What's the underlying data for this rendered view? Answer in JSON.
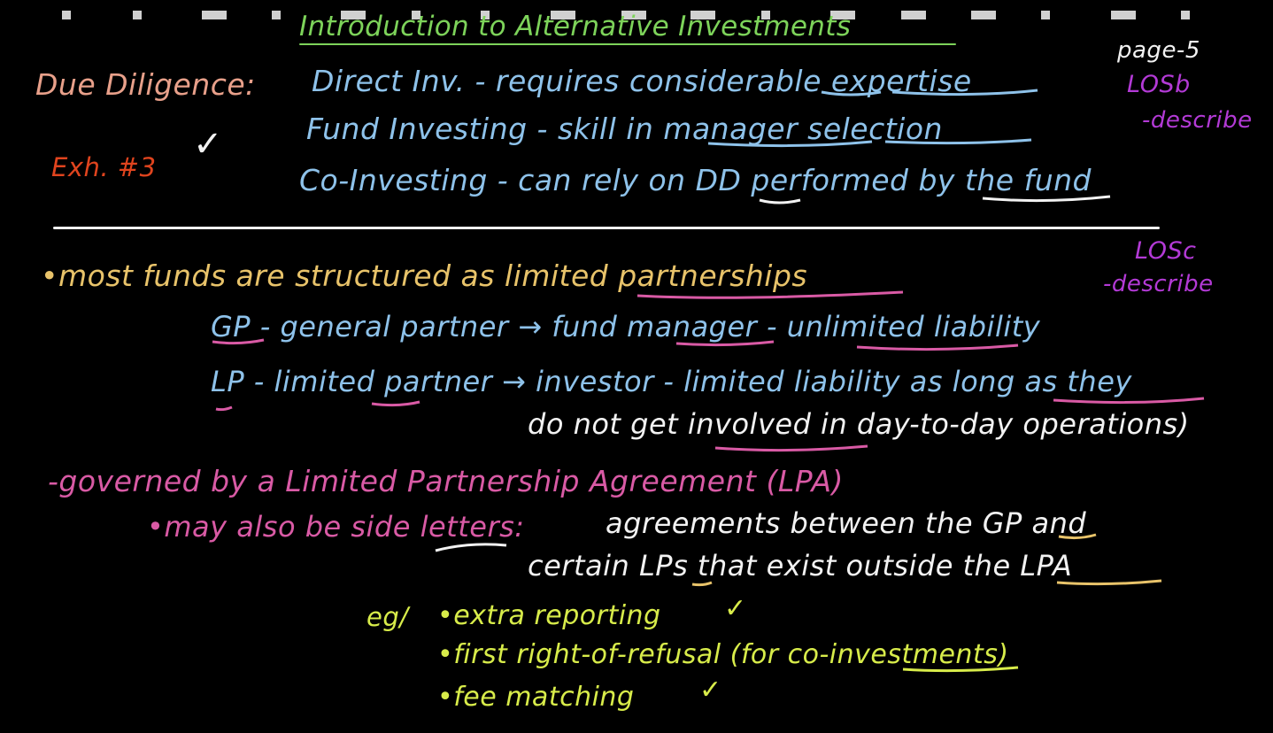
{
  "colors": {
    "background": "#000000",
    "title": "#7dd35a",
    "salmon": "#e8a08a",
    "red": "#e0441e",
    "blue": "#8ec2ea",
    "white": "#f2f2f2",
    "magenta": "#b33ad6",
    "gold": "#e8c36a",
    "pink": "#d95aa5",
    "yellow": "#d8ec4a"
  },
  "header": {
    "title": "Introduction to Alternative Investments",
    "page": "page-5"
  },
  "los": {
    "b": {
      "code": "LOSb",
      "verb": "-describe"
    },
    "c": {
      "code": "LOSc",
      "verb": "-describe"
    }
  },
  "due_diligence": {
    "heading": "Due Diligence:",
    "exhibit": "Exh. #3",
    "check": "✓",
    "lines": [
      "Direct Inv. - requires considerable expertise",
      "Fund Investing - skill in manager selection",
      "Co-Investing - can rely on DD performed by the fund"
    ]
  },
  "structure": {
    "bullet": "•most funds are structured as limited partnerships",
    "gp_line": "GP - general partner → fund manager - unlimited liability",
    "lp_line": "LP - limited partner → investor - limited liability as long as they",
    "lp_line_cont": "do not get involved in day-to-day operations)"
  },
  "lpa": {
    "governed": "-governed by a Limited Partnership Agreement (LPA)",
    "side_letters": "•may also be side letters:",
    "side_def_1": "agreements between the GP and",
    "side_def_2": "certain LPs that exist outside the LPA"
  },
  "examples": {
    "prefix": "eg/",
    "items": [
      "•extra reporting",
      "•first right-of-refusal (for co-investments)",
      "•fee matching"
    ],
    "tick": "✓"
  }
}
